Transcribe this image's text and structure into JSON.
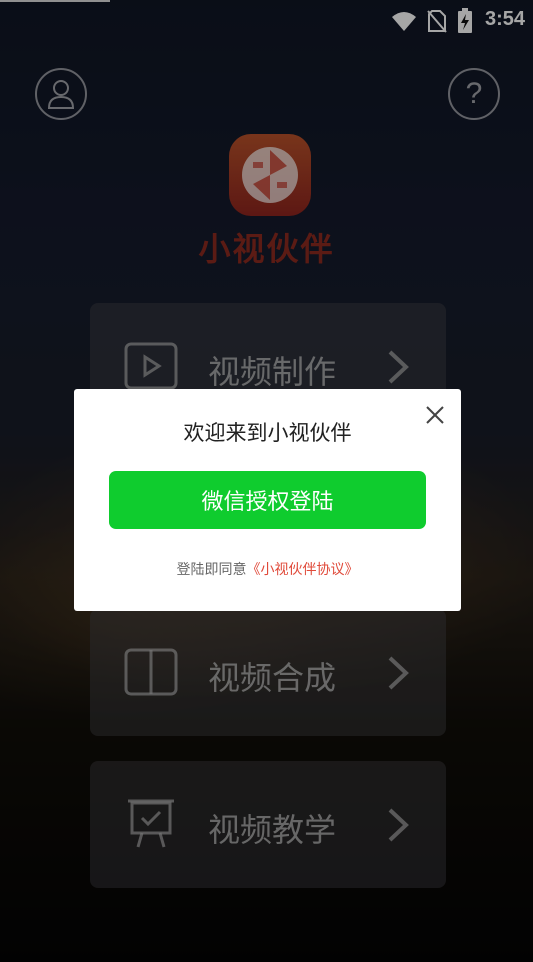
{
  "status_bar": {
    "time": "3:54"
  },
  "header": {
    "help_label": "?"
  },
  "app": {
    "name": "小视伙伴"
  },
  "menu": {
    "items": [
      {
        "label": "视频制作",
        "icon": "play-icon"
      },
      {
        "label": "视频合成",
        "icon": "split-layout-icon"
      },
      {
        "label": "视频教学",
        "icon": "presentation-board-icon"
      }
    ]
  },
  "dialog": {
    "title": "欢迎来到小视伙伴",
    "wechat_button": "微信授权登陆",
    "agree_prefix": "登陆即同意",
    "agree_link": "《小视伙伴协议》"
  },
  "colors": {
    "wechat_green": "#0fcc2e",
    "link_red": "#e04a3a",
    "brand_red": "#c0392b"
  }
}
